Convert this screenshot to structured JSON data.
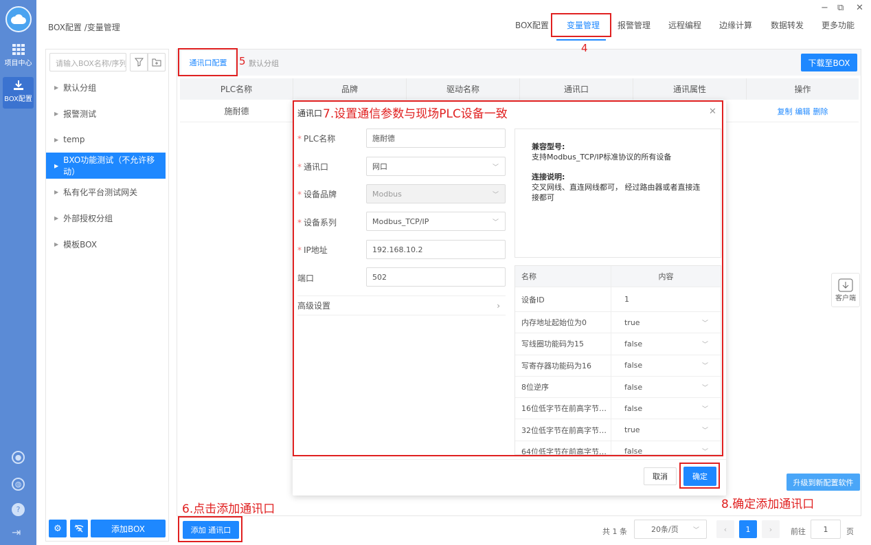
{
  "window": {
    "minimize": "−",
    "restore": "⧉",
    "close": "✕"
  },
  "breadcrumb": "BOX配置 /变量管理",
  "top_tabs": [
    "BOX配置",
    "变量管理",
    "报警管理",
    "远程编程",
    "边缘计算",
    "数据转发",
    "更多功能"
  ],
  "rail": {
    "items": [
      {
        "label": "项目中心",
        "icon": "grid-icon"
      },
      {
        "label": "BOX配置",
        "icon": "download-icon"
      }
    ]
  },
  "sidebar": {
    "search_placeholder": "请输入BOX名称/序列",
    "items": [
      "默认分组",
      "报警测试",
      "temp",
      "BXO功能测试（不允许移动）",
      "私有化平台测试网关",
      "外部授权分组",
      "模板BOX"
    ],
    "add_box": "添加BOX"
  },
  "subtabs": [
    "通讯口配置",
    "默认分组"
  ],
  "download_btn": "下载至BOX",
  "table": {
    "headers": [
      "PLC名称",
      "品牌",
      "驱动名称",
      "通讯口",
      "通讯属性",
      "操作"
    ],
    "row": {
      "plc_name": "施耐德",
      "ops": [
        "复制",
        "编辑",
        "删除"
      ]
    }
  },
  "upgrade_btn": "升级到新配置软件",
  "client_float": "客户端",
  "add_port_btn": "添加 通讯口",
  "pagination": {
    "total": "共 1 条",
    "page_size": "20条/页",
    "current": "1",
    "goto_label": "前往",
    "goto_value": "1",
    "suffix": "页"
  },
  "dialog": {
    "title": "通讯口",
    "fields": [
      {
        "label": "PLC名称",
        "required": true,
        "value": "施耐德"
      },
      {
        "label": "通讯口",
        "required": true,
        "value": "网口"
      },
      {
        "label": "设备品牌",
        "required": true,
        "value": "Modbus"
      },
      {
        "label": "设备系列",
        "required": true,
        "value": "Modbus_TCP/IP"
      },
      {
        "label": "IP地址",
        "required": true,
        "value": "192.168.10.2"
      },
      {
        "label": "端口",
        "required": false,
        "value": "502"
      }
    ],
    "advanced": "高级设置",
    "info": {
      "compat_title": "兼容型号:",
      "compat_text": "支持Modbus_TCP/IP标准协议的所有设备",
      "conn_title": "连接说明:",
      "conn_text": "交叉网线、直连网线都可，  经过路由器或者直接连接都可"
    },
    "param_table": {
      "headers": [
        "名称",
        "内容"
      ],
      "rows": [
        {
          "name": "设备ID",
          "value": "1"
        },
        {
          "name": "内存地址起始位为0",
          "value": "true"
        },
        {
          "name": "写线圈功能码为15",
          "value": "false"
        },
        {
          "name": "写寄存器功能码为16",
          "value": "false"
        },
        {
          "name": "8位逆序",
          "value": "false"
        },
        {
          "name": "16位低字节在前高字节…",
          "value": "false"
        },
        {
          "name": "32位低字节在前高字节…",
          "value": "true"
        },
        {
          "name": "64位低字节在前高字节…",
          "value": "false"
        }
      ]
    },
    "cancel": "取消",
    "ok": "确定"
  },
  "annotations": {
    "step4": "4",
    "step5": "5",
    "step6": "6.点击添加通讯口",
    "step7": "7.设置通信参数与现场PLC设备一致",
    "step8": "8.确定添加通讯口"
  }
}
